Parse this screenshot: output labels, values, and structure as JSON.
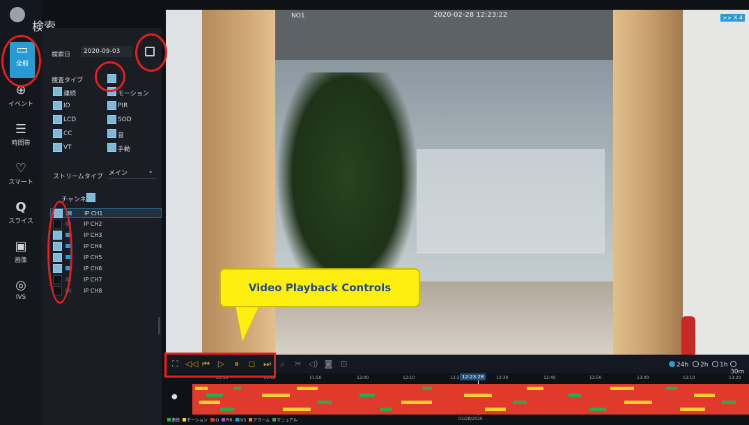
{
  "title": "検索",
  "nav": [
    {
      "label": "全般",
      "icon": "folder-icon",
      "glyph": "▭"
    },
    {
      "label": "イベント",
      "icon": "crosshair-icon",
      "glyph": "⊕"
    },
    {
      "label": "時間帯",
      "icon": "list-icon",
      "glyph": "☰"
    },
    {
      "label": "スマート",
      "icon": "bulb-icon",
      "glyph": "♡"
    },
    {
      "label": "スライス",
      "icon": "magnifier-icon",
      "glyph": "Q"
    },
    {
      "label": "画像",
      "icon": "image-icon",
      "glyph": "▣"
    },
    {
      "label": "IVS",
      "icon": "ivs-icon",
      "glyph": "◎"
    }
  ],
  "search": {
    "date_label": "検索日",
    "date_value": "2020-09-03",
    "type_label": "捜査タイプ",
    "types": [
      "連続",
      "モーション",
      "IO",
      "PIR",
      "LCD",
      "SOD",
      "CC",
      "音",
      "VT",
      "手動"
    ],
    "stream_label": "ストリームタイプ",
    "stream_value": "メイン",
    "channel_label": "チャンネル",
    "channels": [
      "IP CH1",
      "IP CH2",
      "IP CH3",
      "IP CH4",
      "IP CH5",
      "IP CH6",
      "IP CH7",
      "IP CH8"
    ]
  },
  "video": {
    "camera_name": "NO1",
    "timestamp": "2020-02-28 12:23:22",
    "speed": ">> X 4"
  },
  "callout": "Video Playback Controls",
  "ranges": [
    "24h",
    "2h",
    "1h",
    "30m"
  ],
  "timeline": {
    "ticks": [
      "11:30",
      "11:40",
      "11:50",
      "12:00",
      "12:10",
      "12:20",
      "12:30",
      "12:40",
      "12:50",
      "13:00",
      "13:10",
      "13:20"
    ],
    "current": "12:23:28",
    "date": "02/28/2020"
  },
  "legend": [
    {
      "label": "連続",
      "color": "#2fa84f"
    },
    {
      "label": "モーション",
      "color": "#f0d02a"
    },
    {
      "label": "IO",
      "color": "#e03a2c"
    },
    {
      "label": "PIR",
      "color": "#9b59d6"
    },
    {
      "label": "IVS",
      "color": "#2a9bd2"
    },
    {
      "label": "アラーム",
      "color": "#f07d1e"
    },
    {
      "label": "マニュアル",
      "color": "#2fa84f"
    }
  ]
}
